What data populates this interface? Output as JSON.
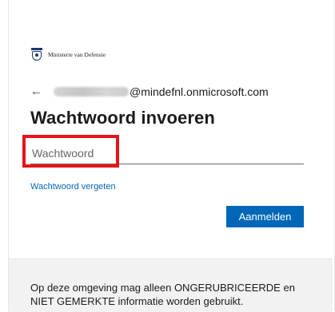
{
  "brand": {
    "name": "Ministerie van Defensie",
    "logo_icon": "rijksoverheid-crest-icon"
  },
  "identity": {
    "back_icon": "back-arrow-icon",
    "back_glyph": "←",
    "email_domain": "@mindefnl.onmicrosoft.com"
  },
  "title": "Wachtwoord invoeren",
  "password_field": {
    "placeholder": "Wachtwoord",
    "value": ""
  },
  "forgot_link": "Wachtwoord vergeten",
  "signin_button": "Aanmelden",
  "notice": "Op deze omgeving mag alleen ONGERUBRICEERDE en NIET GEMERKTE informatie worden gebruikt.",
  "colors": {
    "accent": "#0067b8",
    "highlight": "#e8141a",
    "notice_background": "#f2f2f2"
  }
}
